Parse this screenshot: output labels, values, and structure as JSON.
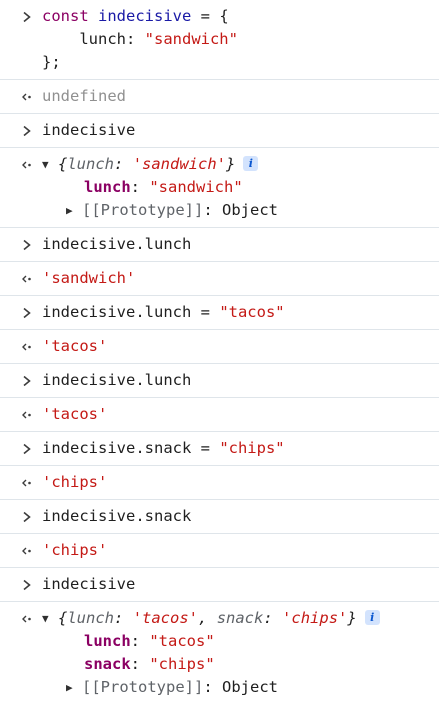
{
  "entries": [
    {
      "kind": "input",
      "lines": [
        {
          "parts": [
            {
              "t": "const",
              "c": "kw"
            },
            {
              "t": " "
            },
            {
              "t": "indecisive",
              "c": "var"
            },
            {
              "t": " = {"
            }
          ]
        },
        {
          "parts": [
            {
              "t": "    lunch: "
            },
            {
              "t": "\"sandwich\"",
              "c": "str"
            }
          ]
        },
        {
          "parts": [
            {
              "t": "};"
            }
          ]
        }
      ]
    },
    {
      "kind": "output",
      "lines": [
        {
          "parts": [
            {
              "t": "undefined",
              "c": "undef"
            }
          ]
        }
      ]
    },
    {
      "kind": "input",
      "lines": [
        {
          "parts": [
            {
              "t": "indecisive"
            }
          ]
        }
      ]
    },
    {
      "kind": "object",
      "summary": [
        {
          "t": "{"
        },
        {
          "t": "lunch",
          "c": "gray"
        },
        {
          "t": ": "
        },
        {
          "t": "'sandwich'",
          "c": "str"
        },
        {
          "t": "}"
        }
      ],
      "props": [
        {
          "key": "lunch",
          "value": "\"sandwich\""
        }
      ],
      "proto": "[[Prototype]]: Object"
    },
    {
      "kind": "input",
      "lines": [
        {
          "parts": [
            {
              "t": "indecisive.lunch"
            }
          ]
        }
      ]
    },
    {
      "kind": "output",
      "lines": [
        {
          "parts": [
            {
              "t": "'sandwich'",
              "c": "str"
            }
          ]
        }
      ]
    },
    {
      "kind": "input",
      "lines": [
        {
          "parts": [
            {
              "t": "indecisive.lunch = "
            },
            {
              "t": "\"tacos\"",
              "c": "str"
            }
          ]
        }
      ]
    },
    {
      "kind": "output",
      "lines": [
        {
          "parts": [
            {
              "t": "'tacos'",
              "c": "str"
            }
          ]
        }
      ]
    },
    {
      "kind": "input",
      "lines": [
        {
          "parts": [
            {
              "t": "indecisive.lunch"
            }
          ]
        }
      ]
    },
    {
      "kind": "output",
      "lines": [
        {
          "parts": [
            {
              "t": "'tacos'",
              "c": "str"
            }
          ]
        }
      ]
    },
    {
      "kind": "input",
      "lines": [
        {
          "parts": [
            {
              "t": "indecisive.snack = "
            },
            {
              "t": "\"chips\"",
              "c": "str"
            }
          ]
        }
      ]
    },
    {
      "kind": "output",
      "lines": [
        {
          "parts": [
            {
              "t": "'chips'",
              "c": "str"
            }
          ]
        }
      ]
    },
    {
      "kind": "input",
      "lines": [
        {
          "parts": [
            {
              "t": "indecisive.snack"
            }
          ]
        }
      ]
    },
    {
      "kind": "output",
      "lines": [
        {
          "parts": [
            {
              "t": "'chips'",
              "c": "str"
            }
          ]
        }
      ]
    },
    {
      "kind": "input",
      "lines": [
        {
          "parts": [
            {
              "t": "indecisive"
            }
          ]
        }
      ]
    },
    {
      "kind": "object",
      "summary": [
        {
          "t": "{"
        },
        {
          "t": "lunch",
          "c": "gray"
        },
        {
          "t": ": "
        },
        {
          "t": "'tacos'",
          "c": "str"
        },
        {
          "t": ", "
        },
        {
          "t": "snack",
          "c": "gray"
        },
        {
          "t": ": "
        },
        {
          "t": "'chips'",
          "c": "str"
        },
        {
          "t": "}"
        }
      ],
      "props": [
        {
          "key": "lunch",
          "value": "\"tacos\""
        },
        {
          "key": "snack",
          "value": "\"chips\""
        }
      ],
      "proto": "[[Prototype]]: Object"
    }
  ],
  "icons": {
    "input_prompt": "chevron-right-icon",
    "output_prompt": "return-arrow-icon",
    "expand": "triangle-down-icon",
    "collapse": "triangle-right-icon",
    "info": "info-icon"
  },
  "info_badge_text": "i",
  "colors": {
    "keyword": "#8b0063",
    "variable": "#1a1aa6",
    "string": "#c41a16",
    "undefined": "#909090",
    "divider": "#dfe5ea",
    "badge_bg": "#d3e3fd"
  }
}
